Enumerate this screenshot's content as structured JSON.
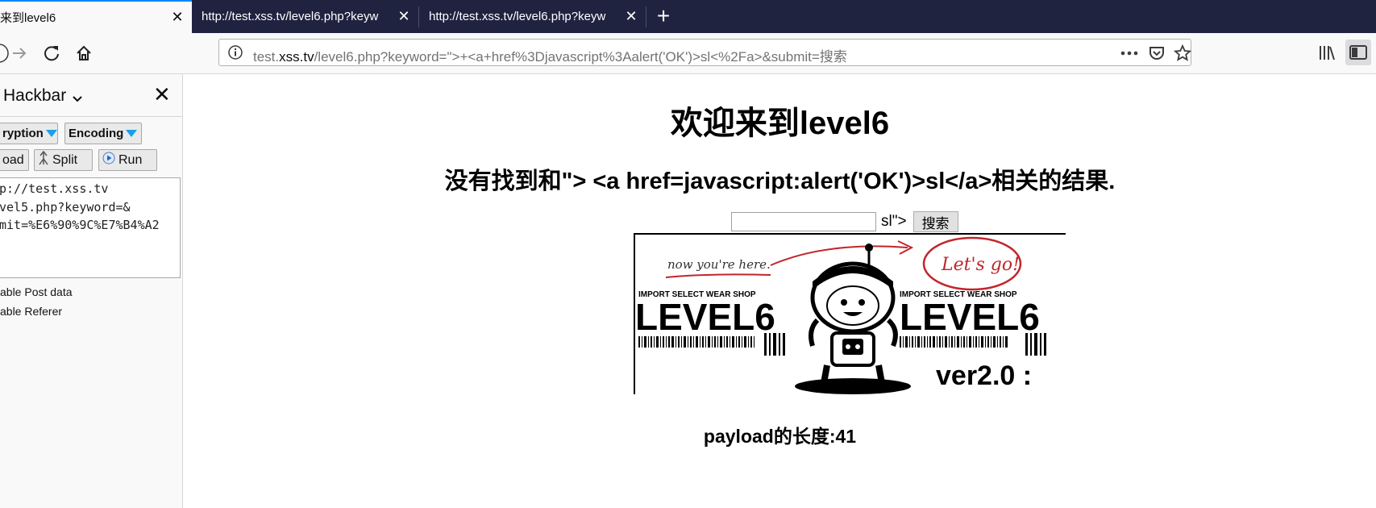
{
  "tabs": [
    {
      "title": "来到level6",
      "close": "✕",
      "active": true
    },
    {
      "title": "http://test.xss.tv/level6.php?keyw",
      "close": "✕",
      "active": false
    },
    {
      "title": "http://test.xss.tv/level6.php?keyw",
      "close": "✕",
      "active": false
    }
  ],
  "new_tab": "+",
  "url": {
    "prefix": "test.",
    "host": "xss.tv",
    "rest": "/level6.php?keyword=\">+<a+href%3Djavascript%3Aalert('OK')>sl<%2Fa>&submit=搜索"
  },
  "sidebar": {
    "title": "Hackbar",
    "buttons_row1": [
      {
        "label": "ryption"
      },
      {
        "label": "Encoding"
      }
    ],
    "buttons_row2": [
      {
        "label": "oad"
      },
      {
        "label": "Split"
      },
      {
        "label": "Run"
      }
    ],
    "textarea": "p://test.xss.tv\nvel5.php?keyword=&\nmit=%E6%90%9C%E7%B4%A2",
    "options": [
      "able Post data",
      "able Referer"
    ]
  },
  "page": {
    "heading": "欢迎来到level6",
    "result": "没有找到和\"> <a href=javascript:alert('OK')>sl</a>相关的结果.",
    "search_suffix": "sl\">",
    "search_button": "搜索",
    "banner": {
      "note": "now you're here.",
      "bubble": "Let's go!",
      "shop": "IMPORT SELECT WEAR SHOP",
      "level": "LEVEL6",
      "version": "ver2.0 :"
    },
    "payload": "payload的长度:41"
  },
  "colors": {
    "tabbar": "#202340",
    "accent": "#0a84ff",
    "bubble_red": "#c0262c",
    "triangle": "#1a9fe8"
  }
}
